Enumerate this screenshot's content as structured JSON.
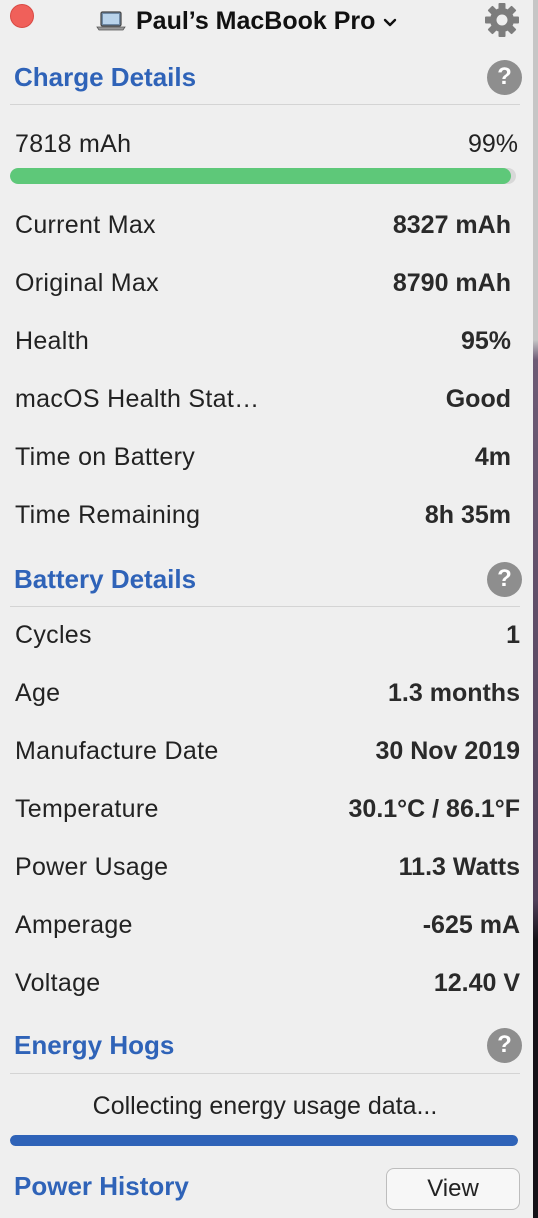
{
  "titlebar": {
    "device_name": "Paul’s MacBook Pro",
    "device_icon": "laptop-icon",
    "dropdown_icon": "chevron-down-icon",
    "settings_icon": "gear-icon"
  },
  "charge_details": {
    "title": "Charge Details",
    "help": "?",
    "current_charge": "7818 mAh",
    "percent": "99%",
    "charge_fraction": 0.99,
    "bar_color": "#5ec879",
    "rows": [
      {
        "label": "Current Max",
        "value": "8327 mAh"
      },
      {
        "label": "Original Max",
        "value": "8790 mAh"
      },
      {
        "label": "Health",
        "value": "95%"
      },
      {
        "label": "macOS Health Stat…",
        "value": "Good"
      },
      {
        "label": "Time on Battery",
        "value": "4m"
      },
      {
        "label": "Time Remaining",
        "value": "8h 35m"
      }
    ]
  },
  "battery_details": {
    "title": "Battery Details",
    "help": "?",
    "rows": [
      {
        "label": "Cycles",
        "value": "1"
      },
      {
        "label": "Age",
        "value": "1.3 months"
      },
      {
        "label": "Manufacture Date",
        "value": "30 Nov 2019"
      },
      {
        "label": "Temperature",
        "value": "30.1°C / 86.1°F"
      },
      {
        "label": "Power Usage",
        "value": "11.3 Watts"
      },
      {
        "label": "Amperage",
        "value": "-625 mA"
      },
      {
        "label": "Voltage",
        "value": "12.40 V"
      }
    ]
  },
  "energy_hogs": {
    "title": "Energy Hogs",
    "help": "?",
    "status": "Collecting energy usage data...",
    "progress_fraction": 1.0,
    "bar_color": "#2f63b8"
  },
  "power_history": {
    "title": "Power History",
    "button_label": "View"
  },
  "colors": {
    "accent": "#2f63b8",
    "close": "#f0605a",
    "background": "#efefef"
  }
}
